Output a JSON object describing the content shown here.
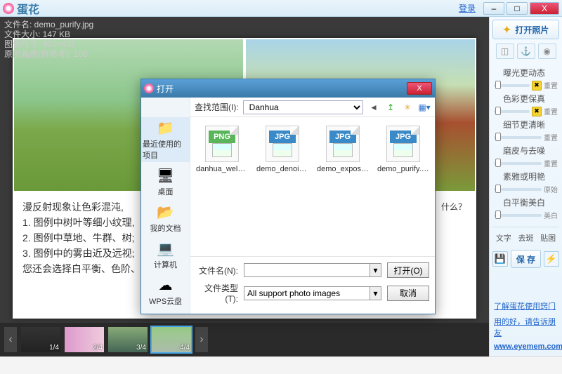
{
  "app": {
    "title": "蛋花",
    "login": "登录"
  },
  "win": {
    "min": "–",
    "max": "□",
    "close": "X"
  },
  "fileinfo": {
    "l1": "文件名: demo_purify.jpg",
    "l2": "文件大小: 147 KB",
    "l3": "图像尺寸: 907×422",
    "l4": "原图画质(供参考): 100"
  },
  "doc": {
    "lead": "漫反射现象让色彩混沌,",
    "q": "什么？",
    "p1": "1. 图例中树叶等细小纹理,",
    "p2": "2. 图例中草地、牛群、树;",
    "p3": "3. 图例中的雾由近及远视;",
    "p4": "您还会选择白平衡、色阶、"
  },
  "thumbs": [
    {
      "n": "1/4"
    },
    {
      "n": "2/4"
    },
    {
      "n": "3/4"
    },
    {
      "n": "4/4"
    }
  ],
  "sidebar": {
    "open": "打开照片",
    "adjustments": [
      {
        "label": "曝光更动态"
      },
      {
        "label": "色彩更保真"
      },
      {
        "label": "细节更清晰"
      },
      {
        "label": "磨皮与去噪"
      },
      {
        "label": "素雅或明艳"
      },
      {
        "label": "白平衡美白"
      }
    ],
    "reset": "重置",
    "reset2": "原始",
    "reset3": "美白",
    "tabs": [
      "文字",
      "去斑",
      "贴图"
    ],
    "save": "保 存",
    "links": {
      "l1": "了解蛋花使用窍门",
      "l2": "用的好，请告诉朋友",
      "site": "www.eyemem.com"
    }
  },
  "dialog": {
    "title": "打开",
    "look_label": "查找范围(I):",
    "folder": "Danhua",
    "nav": [
      {
        "label": "最近使用的项目",
        "icon": "📁"
      },
      {
        "label": "桌面",
        "icon": "🖥"
      },
      {
        "label": "我的文档",
        "icon": "📂"
      },
      {
        "label": "计算机",
        "icon": "💻"
      },
      {
        "label": "WPS云盘",
        "icon": "☁"
      }
    ],
    "files": [
      {
        "name": "danhua_welco...",
        "ext": "PNG",
        "cls": "png"
      },
      {
        "name": "demo_denoise...",
        "ext": "JPG",
        "cls": "jpg"
      },
      {
        "name": "demo_exposur...",
        "ext": "JPG",
        "cls": "jpg"
      },
      {
        "name": "demo_purify.jpg",
        "ext": "JPG",
        "cls": "jpg"
      }
    ],
    "filename_label": "文件名(N):",
    "filetype_label": "文件类型(T):",
    "filetype_value": "All support photo images",
    "open_btn": "打开(O)",
    "cancel_btn": "取消"
  }
}
